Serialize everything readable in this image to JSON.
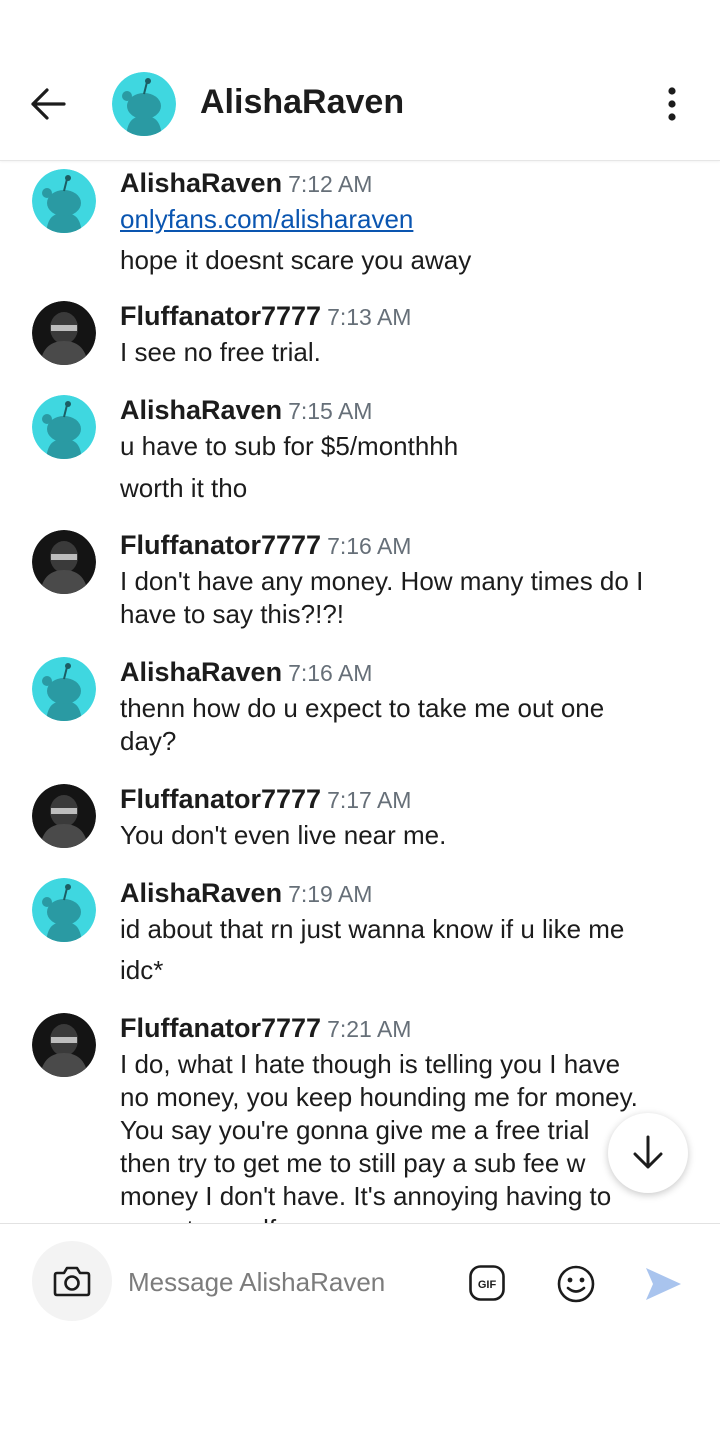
{
  "header": {
    "title": "AlishaRaven",
    "back_icon": "arrow-left-icon",
    "more_icon": "more-vertical-icon"
  },
  "messages": [
    {
      "author": "AlishaRaven",
      "time": "7:12 AM",
      "lines": [
        "onlyfans.com/alisharaven",
        "hope it doesnt scare you away"
      ],
      "link": true
    },
    {
      "author": "Fluffanator7777",
      "time": "7:13 AM",
      "lines": [
        "I see no free trial."
      ]
    },
    {
      "author": "AlishaRaven",
      "time": "7:15 AM",
      "lines": [
        "u have to sub for $5/monthhh",
        "worth it tho"
      ]
    },
    {
      "author": "Fluffanator7777",
      "time": "7:16 AM",
      "lines": [
        "I don't have any money. How many times do I",
        "have to say this?!?!"
      ]
    },
    {
      "author": "AlishaRaven",
      "time": "7:16 AM",
      "lines": [
        "thenn how do u expect to take me out one",
        "day?"
      ]
    },
    {
      "author": "Fluffanator7777",
      "time": "7:17 AM",
      "lines": [
        "You don't even live near me."
      ]
    },
    {
      "author": "AlishaRaven",
      "time": "7:19 AM",
      "lines": [
        "id about that rn just wanna know if u like me",
        "idc*"
      ]
    },
    {
      "author": "Fluffanator7777",
      "time": "7:21 AM",
      "lines": [
        "I do, what I hate though is telling you I have",
        "no money, you keep hounding me for money.",
        "You say you're gonna give me a free trial",
        "then try to get me to still pay a sub fee w",
        "money I don't have. It's annoying having to",
        "repeat myself."
      ]
    }
  ],
  "composer": {
    "placeholder": "Message AlishaRaven",
    "gif_label": "GIF",
    "camera_icon": "camera-icon",
    "emoji_icon": "emoji-icon",
    "send_icon": "send-icon"
  },
  "scroll_down_icon": "arrow-down-icon",
  "colors": {
    "reddit_avatar_bg": "#3fd7e0",
    "link": "#0a55b0",
    "timestamp": "#666f78",
    "send": "#a9c4ee"
  }
}
